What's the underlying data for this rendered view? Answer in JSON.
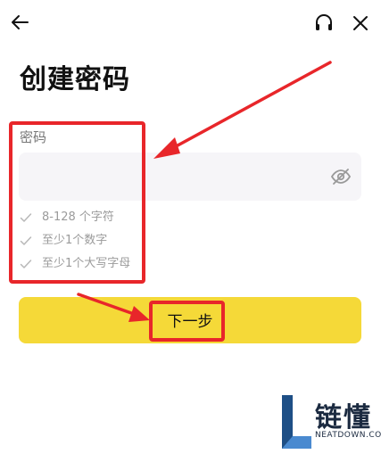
{
  "header": {
    "back_icon": "arrow-left-icon",
    "support_icon": "headset-icon",
    "close_icon": "close-icon"
  },
  "page": {
    "title": "创建密码"
  },
  "password": {
    "label": "密码",
    "value": "",
    "placeholder": "",
    "visibility_icon": "eye-off-icon"
  },
  "rules": [
    {
      "text": "8-128 个字符",
      "icon": "check-icon"
    },
    {
      "text": "至少1个数字",
      "icon": "check-icon"
    },
    {
      "text": "至少1个大写字母",
      "icon": "check-icon"
    }
  ],
  "actions": {
    "next_label": "下一步"
  },
  "annotation": {
    "highlight_color": "#e8262a"
  },
  "watermark": {
    "name": "链懂",
    "domain": "NEATDOWN.COM"
  },
  "colors": {
    "primary": "#f5d938",
    "field_bg": "#f6f5f8",
    "muted": "#9b9b9b"
  }
}
